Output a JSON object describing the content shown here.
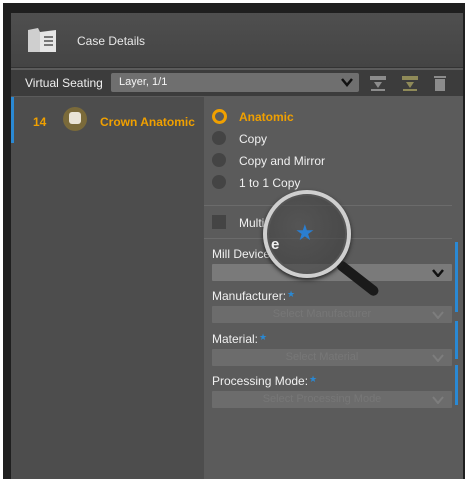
{
  "header": {
    "title": "Case Details",
    "icon": "case-folder-icon"
  },
  "toolbar": {
    "label": "Virtual Seating",
    "layer_value": "Layer, 1/1",
    "icons": [
      "add-layer-icon",
      "remove-layer-icon",
      "trash-icon"
    ]
  },
  "tooth": {
    "number": "14",
    "name": "Crown Anatomic",
    "icon": "tooth-icon"
  },
  "options": {
    "items": [
      "Anatomic",
      "Copy",
      "Copy and Mirror",
      "1 to 1 Copy"
    ],
    "selected": "Anatomic"
  },
  "multi_label": "Multi",
  "fields": {
    "mill_device": {
      "label": "Mill Device",
      "value": ""
    },
    "manufacturer": {
      "label": "Manufacturer:",
      "placeholder": "Select Manufacturer"
    },
    "material": {
      "label": "Material:",
      "placeholder": "Select Material"
    },
    "processing_mode": {
      "label": "Processing Mode:",
      "placeholder": "Select Processing Mode"
    }
  },
  "magnifier": {
    "icon": "magnifier-icon"
  },
  "colors": {
    "accent_orange": "#f0a000",
    "accent_blue": "#2a89d4",
    "panel": "#5b5b5b"
  }
}
